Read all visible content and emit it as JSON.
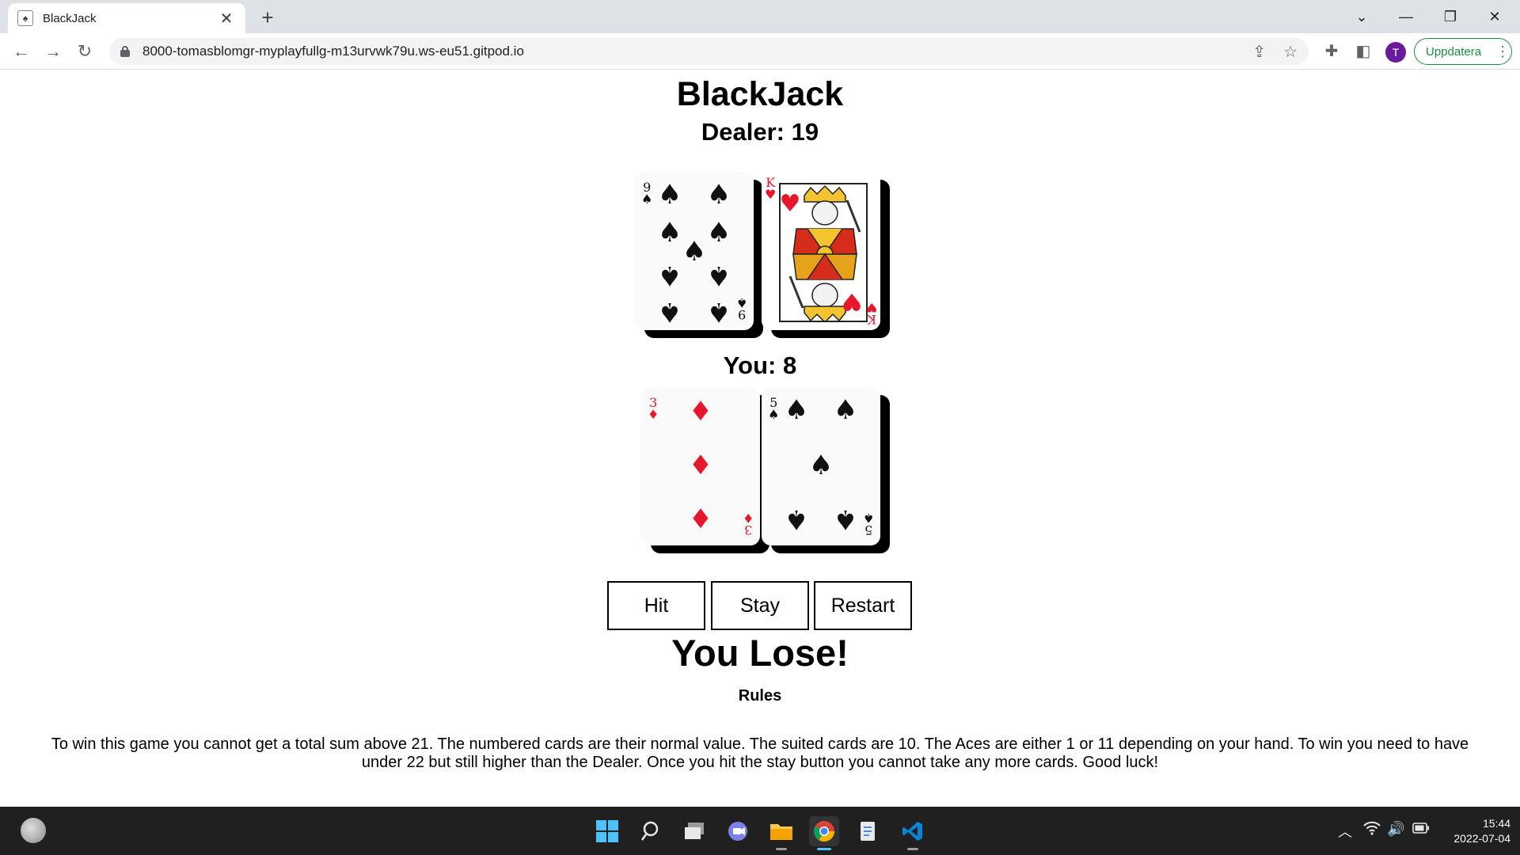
{
  "browser": {
    "tab_title": "BlackJack",
    "tab_favicon": "♠",
    "url": "8000-tomasblomgr-myplayfullg-m13urvwk79u.ws-eu51.gitpod.io",
    "update_label": "Uppdatera",
    "avatar_letter": "T"
  },
  "game": {
    "title": "BlackJack",
    "dealer_label": "Dealer: 19",
    "player_label": "You: 8",
    "dealer_cards": [
      {
        "rank": "9",
        "suit": "♠",
        "color": "black"
      },
      {
        "rank": "K",
        "suit": "♥",
        "color": "red"
      }
    ],
    "player_cards": [
      {
        "rank": "3",
        "suit": "♦",
        "color": "red"
      },
      {
        "rank": "5",
        "suit": "♠",
        "color": "black"
      }
    ],
    "buttons": {
      "hit": "Hit",
      "stay": "Stay",
      "restart": "Restart"
    },
    "result": "You Lose!",
    "rules_title": "Rules",
    "rules_text": "To win this game you cannot get a total sum above 21. The numbered cards are their normal value. The suited cards are 10. The Aces are either 1 or 11 depending on your hand. To win you need to have under 22 but still higher than the Dealer. Once you hit the stay button you cannot take any more cards. Good luck!"
  },
  "taskbar": {
    "time": "15:44",
    "date": "2022-07-04"
  }
}
